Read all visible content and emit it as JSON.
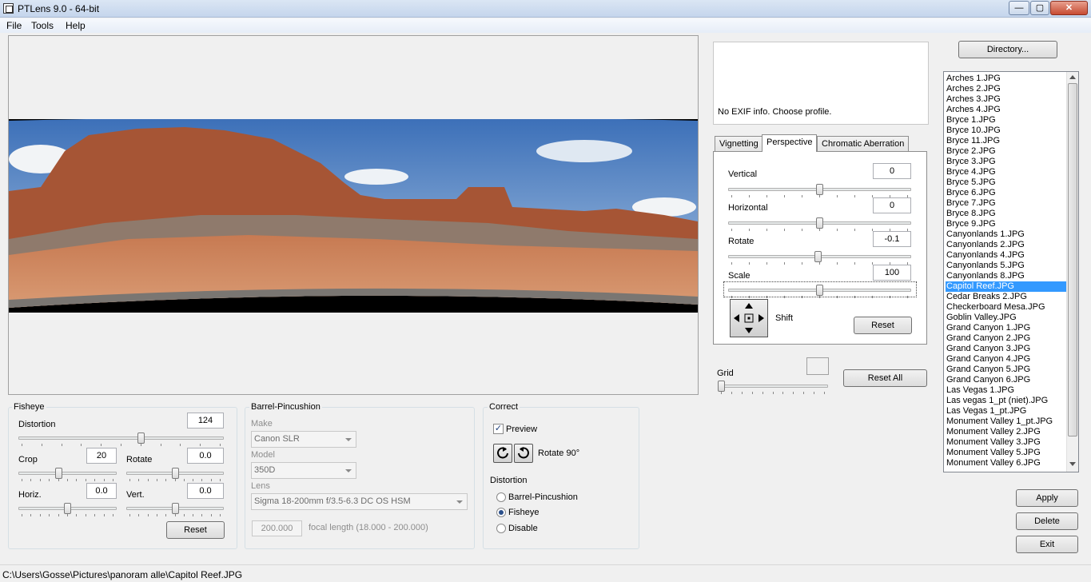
{
  "window": {
    "title": "PTLens 9.0 - 64-bit",
    "minimize": "—",
    "maximize": "▢",
    "close": "✕"
  },
  "menu": {
    "file": "File",
    "tools": "Tools",
    "help": "Help"
  },
  "exif": {
    "message": "No EXIF info. Choose profile."
  },
  "tabs": {
    "vignetting": "Vignetting",
    "perspective": "Perspective",
    "chromatic": "Chromatic Aberration"
  },
  "perspective": {
    "vertical": {
      "label": "Vertical",
      "value": "0",
      "level": 0.5
    },
    "horizontal": {
      "label": "Horizontal",
      "value": "0",
      "level": 0.5
    },
    "rotate": {
      "label": "Rotate",
      "value": "-0.1",
      "level": 0.49
    },
    "scale": {
      "label": "Scale",
      "value": "100",
      "level": 0.5
    },
    "shift_label": "Shift",
    "reset": "Reset"
  },
  "grid": {
    "label": "Grid",
    "level": 0.0,
    "reset_all": "Reset All"
  },
  "fisheye": {
    "title": "Fisheye",
    "distortion": {
      "label": "Distortion",
      "value": "124",
      "level": 0.6
    },
    "crop": {
      "label": "Crop",
      "value": "20",
      "level": 0.4
    },
    "rotate": {
      "label": "Rotate",
      "value": "0.0",
      "level": 0.5
    },
    "horiz": {
      "label": "Horiz.",
      "value": "0.0",
      "level": 0.5
    },
    "vert": {
      "label": "Vert.",
      "value": "0.0",
      "level": 0.5
    },
    "reset": "Reset"
  },
  "barrel": {
    "title": "Barrel-Pincushion",
    "make_label": "Make",
    "make_value": "Canon SLR",
    "model_label": "Model",
    "model_value": "350D",
    "lens_label": "Lens",
    "lens_value": "Sigma 18-200mm f/3.5-6.3 DC OS HSM",
    "focal_value": "200.000",
    "focal_label": "focal length (18.000 - 200.000)"
  },
  "correct": {
    "title": "Correct",
    "preview": "Preview",
    "rotate90": "Rotate 90°",
    "distortion_title": "Distortion",
    "options": [
      "Barrel-Pincushion",
      "Fisheye",
      "Disable"
    ],
    "selected": "Fisheye"
  },
  "buttons": {
    "directory": "Directory...",
    "apply": "Apply",
    "delete": "Delete",
    "exit": "Exit"
  },
  "files": [
    "Arches 1.JPG",
    "Arches 2.JPG",
    "Arches 3.JPG",
    "Arches 4.JPG",
    "Bryce 1.JPG",
    "Bryce 10.JPG",
    "Bryce 11.JPG",
    "Bryce 2.JPG",
    "Bryce 3.JPG",
    "Bryce 4.JPG",
    "Bryce 5.JPG",
    "Bryce 6.JPG",
    "Bryce 7.JPG",
    "Bryce 8.JPG",
    "Bryce 9.JPG",
    "Canyonlands 1.JPG",
    "Canyonlands 2.JPG",
    "Canyonlands 4.JPG",
    "Canyonlands 5.JPG",
    "Canyonlands 8.JPG",
    "Capitol Reef.JPG",
    "Cedar Breaks 2.JPG",
    "Checkerboard Mesa.JPG",
    "Goblin Valley.JPG",
    "Grand Canyon 1.JPG",
    "Grand Canyon 2.JPG",
    "Grand Canyon 3.JPG",
    "Grand Canyon 4.JPG",
    "Grand Canyon 5.JPG",
    "Grand Canyon 6.JPG",
    "Las Vegas 1.JPG",
    "Las vegas 1_pt (niet).JPG",
    "Las Vegas 1_pt.JPG",
    "Monument Valley 1_pt.JPG",
    "Monument Valley 2.JPG",
    "Monument Valley 3.JPG",
    "Monument Valley 5.JPG",
    "Monument Valley 6.JPG"
  ],
  "selected_file": "Capitol Reef.JPG",
  "status": {
    "path": "C:\\Users\\Gosse\\Pictures\\panoram alle\\Capitol Reef.JPG"
  }
}
